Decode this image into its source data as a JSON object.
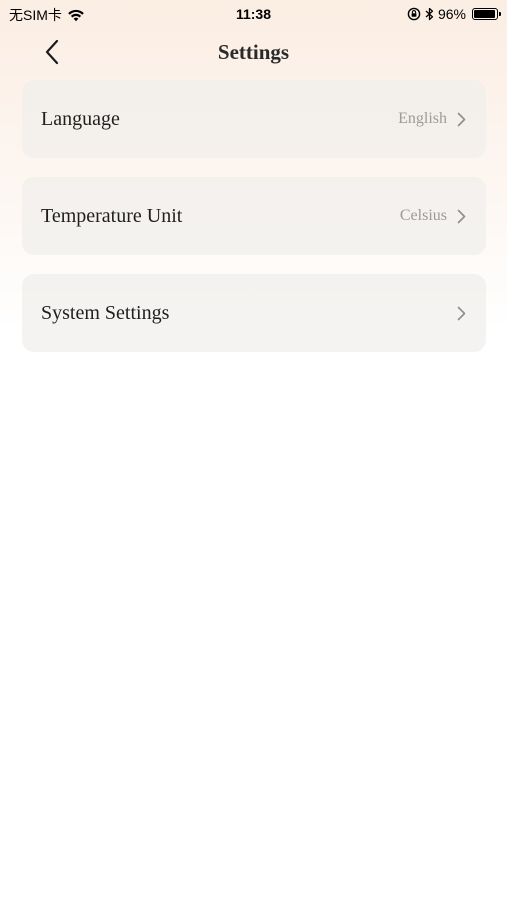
{
  "status_bar": {
    "carrier": "无SIM卡",
    "time": "11:38",
    "battery_percent": "96%",
    "battery_level": 0.96,
    "icons": [
      "wifi-icon",
      "orientation-lock-icon",
      "bluetooth-icon",
      "battery-icon"
    ]
  },
  "nav": {
    "title": "Settings",
    "back_icon": "chevron-left-icon"
  },
  "settings": {
    "items": [
      {
        "label": "Language",
        "value": "English"
      },
      {
        "label": "Temperature Unit",
        "value": "Celsius"
      },
      {
        "label": "System Settings",
        "value": ""
      }
    ]
  },
  "colors": {
    "background_top": "#fbeee3",
    "background_bottom": "#ffffff",
    "card_background": "#f0eeec",
    "value_text": "#9b9b9b",
    "chevron": "#8e8e8e"
  }
}
